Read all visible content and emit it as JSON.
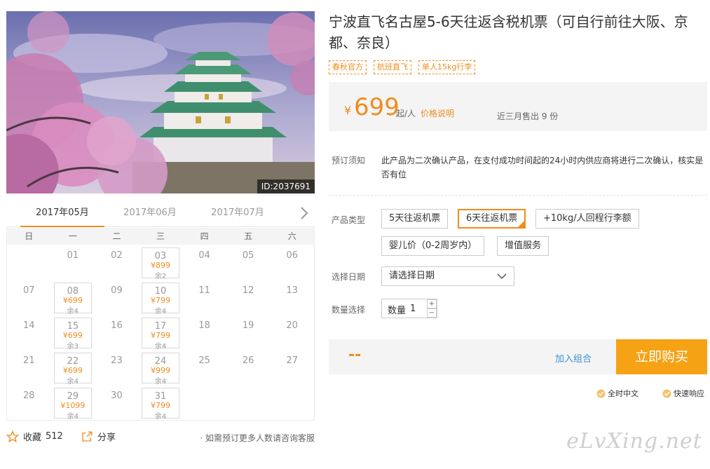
{
  "product": {
    "title": "宁波直飞名古屋5-6天往返含税机票（可自行前往大阪、京都、奈良）",
    "photo_id": "ID:2037691",
    "tags": [
      "春秋官方",
      "航班直飞",
      "单人15kg行李"
    ]
  },
  "price": {
    "currency": "¥",
    "value": "699",
    "unit": "起/人",
    "explain_link": "价格说明",
    "sales": "近三月售出 9 份"
  },
  "notice": {
    "label": "预订须知",
    "text": "此产品为二次确认产品，在支付成功时间起的24小时内供应商将进行二次确认，核实是否有位"
  },
  "options": {
    "label": "产品类型",
    "items": [
      "5天往返机票",
      "6天往返机票",
      "+10kg/人回程行李额",
      "婴儿价（0-2周岁内）",
      "增值服务"
    ],
    "selected": "6天往返机票"
  },
  "date": {
    "label": "选择日期",
    "placeholder": "请选择日期"
  },
  "quantity": {
    "label": "数量选择",
    "text": "数量",
    "value": "1",
    "plus": "+",
    "minus": "−"
  },
  "action": {
    "total": "--",
    "add_combo": "加入组合",
    "buy": "立即购买"
  },
  "badges": [
    "全时中文",
    "快速响应"
  ],
  "calendar": {
    "months": [
      "2017年05月",
      "2017年06月",
      "2017年07月"
    ],
    "active_month": "2017年05月",
    "weekdays": [
      "日",
      "一",
      "二",
      "三",
      "四",
      "五",
      "六"
    ],
    "weeks": [
      [
        {
          "d": ""
        },
        {
          "d": "01"
        },
        {
          "d": "02"
        },
        {
          "d": "03",
          "p": "¥899",
          "r": "余2"
        },
        {
          "d": "04"
        },
        {
          "d": "05"
        },
        {
          "d": "06"
        }
      ],
      [
        {
          "d": "07"
        },
        {
          "d": "08",
          "p": "¥699",
          "r": "余4"
        },
        {
          "d": "09"
        },
        {
          "d": "10",
          "p": "¥799",
          "r": "余4"
        },
        {
          "d": "11"
        },
        {
          "d": "12"
        },
        {
          "d": "13"
        }
      ],
      [
        {
          "d": "14"
        },
        {
          "d": "15",
          "p": "¥699",
          "r": "余3"
        },
        {
          "d": "16"
        },
        {
          "d": "17",
          "p": "¥799",
          "r": "余4"
        },
        {
          "d": "18"
        },
        {
          "d": "19"
        },
        {
          "d": "20"
        }
      ],
      [
        {
          "d": "21"
        },
        {
          "d": "22",
          "p": "¥699",
          "r": "余4"
        },
        {
          "d": "23"
        },
        {
          "d": "24",
          "p": "¥999",
          "r": "余4"
        },
        {
          "d": "25"
        },
        {
          "d": "26"
        },
        {
          "d": "27"
        }
      ],
      [
        {
          "d": "28"
        },
        {
          "d": "29",
          "p": "¥1099",
          "r": "余4"
        },
        {
          "d": "30"
        },
        {
          "d": "31",
          "p": "¥799",
          "r": "余4"
        },
        {
          "d": ""
        },
        {
          "d": ""
        },
        {
          "d": ""
        }
      ]
    ]
  },
  "social": {
    "favorite": "收藏",
    "favorite_count": "512",
    "share": "分享",
    "consult": "· 如需预订更多人数请咨询客服"
  },
  "watermark": "eLvXing.net",
  "colors": {
    "accent": "#f08c1e",
    "buy_button": "#f5a215",
    "link": "#3b8fd6",
    "panel": "#f4f4f4"
  }
}
